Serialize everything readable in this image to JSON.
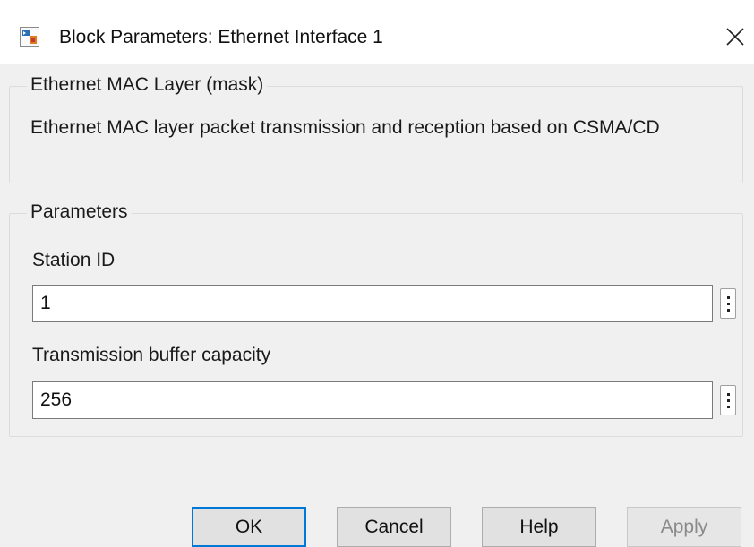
{
  "window": {
    "title": "Block Parameters: Ethernet Interface 1"
  },
  "mask_group": {
    "legend": "Ethernet MAC Layer (mask)",
    "description": "Ethernet MAC layer packet transmission and reception based on CSMA/CD"
  },
  "parameters": {
    "legend": "Parameters",
    "station_id": {
      "label": "Station ID",
      "value": "1"
    },
    "buffer_capacity": {
      "label": "Transmission buffer capacity",
      "value": "256"
    }
  },
  "buttons": {
    "ok": "OK",
    "cancel": "Cancel",
    "help": "Help",
    "apply": "Apply"
  },
  "icons": {
    "app": "simulink-block-icon",
    "close": "close-icon",
    "more": "vertical-ellipsis-icon"
  },
  "colors": {
    "focus_border": "#0078d7",
    "window_bg": "#f0f0f0",
    "disabled_text": "#8a8a8a"
  }
}
